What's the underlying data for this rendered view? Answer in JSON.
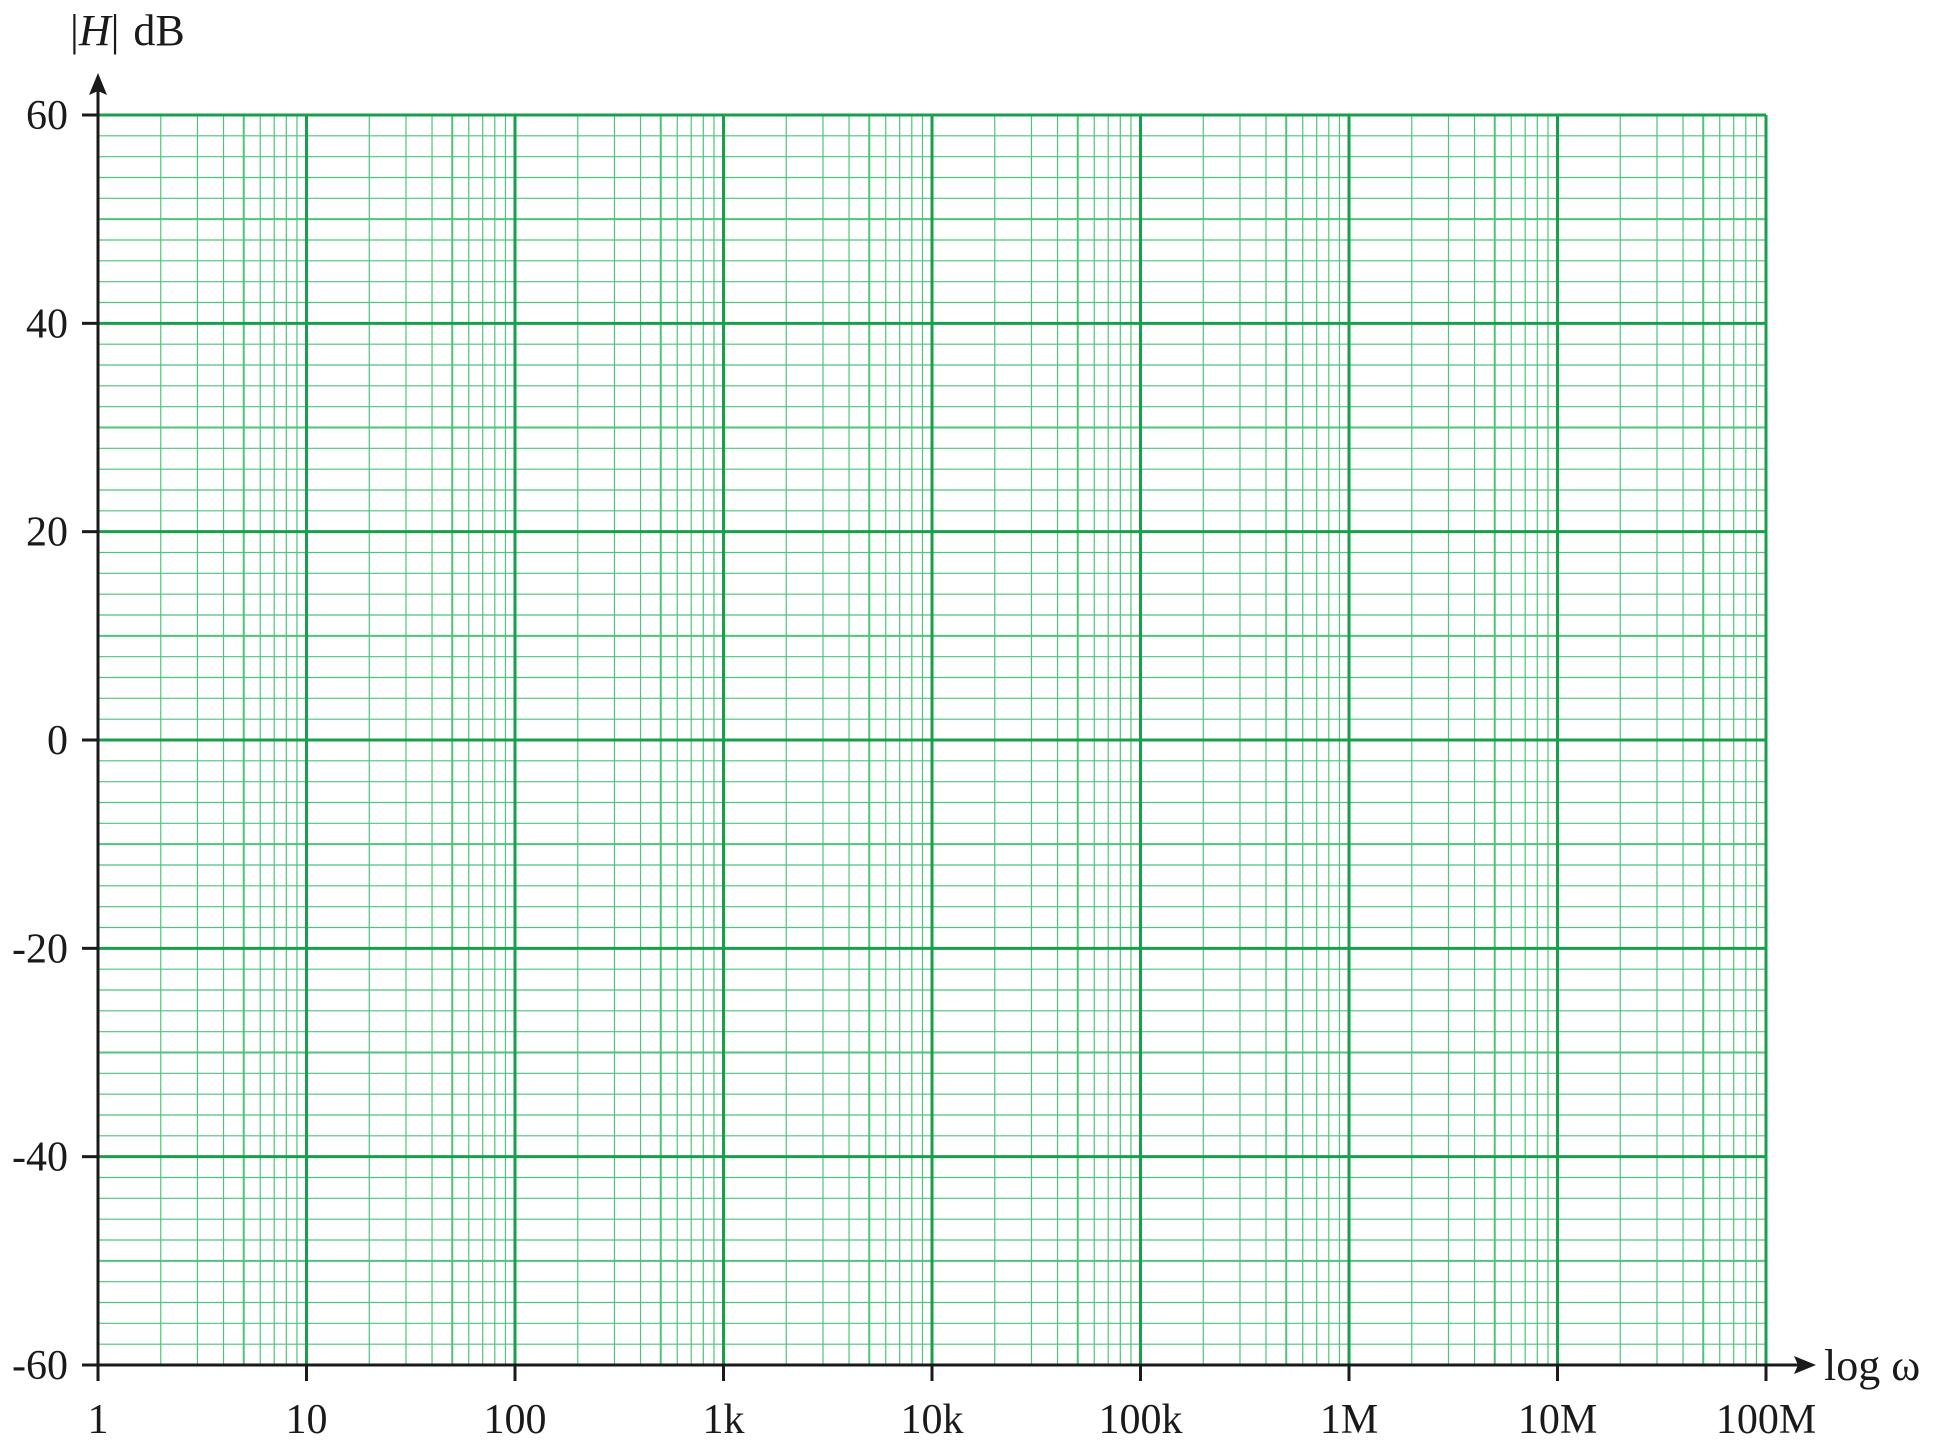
{
  "colors": {
    "grid_major": "#17a04b",
    "grid_minor": "#4cc47a",
    "axis": "#1a1a1a",
    "text": "#1a1a1a"
  },
  "chart_data": {
    "type": "line",
    "title": "",
    "ylabel_symbol": "H",
    "ylabel_unit": "dB",
    "xlabel": "log ω",
    "x_scale": "log",
    "xlim": [
      1,
      100000000
    ],
    "ylim": [
      -60,
      60
    ],
    "x_ticks": [
      {
        "value": 1,
        "label": "1"
      },
      {
        "value": 10,
        "label": "10"
      },
      {
        "value": 100,
        "label": "100"
      },
      {
        "value": 1000,
        "label": "1k"
      },
      {
        "value": 10000,
        "label": "10k"
      },
      {
        "value": 100000,
        "label": "100k"
      },
      {
        "value": 1000000,
        "label": "1M"
      },
      {
        "value": 10000000,
        "label": "10M"
      },
      {
        "value": 100000000,
        "label": "100M"
      }
    ],
    "y_ticks": [
      {
        "value": 60,
        "label": "60"
      },
      {
        "value": 40,
        "label": "40"
      },
      {
        "value": 20,
        "label": "20"
      },
      {
        "value": 0,
        "label": "0"
      },
      {
        "value": -20,
        "label": "-20"
      },
      {
        "value": -40,
        "label": "-40"
      },
      {
        "value": -60,
        "label": "-60"
      }
    ],
    "grid": true,
    "grid_style": "semilog paper, minor lines every 2 dB",
    "series": []
  }
}
